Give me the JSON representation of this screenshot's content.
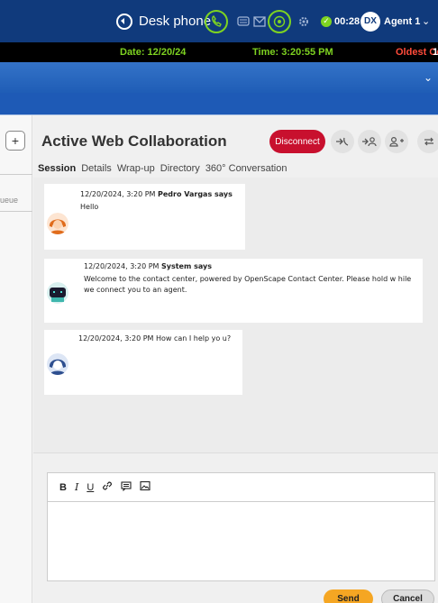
{
  "topbar": {
    "phone_mode_label": "Desk phone",
    "timer": "00:28",
    "agent_initials": "DX",
    "agent_name": "Agent 1"
  },
  "infobar": {
    "date": "Date: 12/20/24",
    "time": "Time: 3:20:55 PM",
    "oldest": "Oldest Co",
    "extra": "1"
  },
  "leftrail": {
    "plus_label": "+",
    "queue_label": "ueue"
  },
  "panel": {
    "title": "Active Web Collaboration",
    "disconnect_label": "Disconnect"
  },
  "tabs": [
    {
      "label": "Session"
    },
    {
      "label": "Details"
    },
    {
      "label": "Wrap-up"
    },
    {
      "label": "Directory"
    },
    {
      "label": "360° Conversation"
    }
  ],
  "messages": [
    {
      "timestamp": "12/20/2024, 3:20 PM",
      "sender": "Pedro Vargas says",
      "text": "Hello"
    },
    {
      "timestamp": "12/20/2024, 3:20 PM",
      "sender": "System says",
      "text": "Welcome to the contact center, powered by OpenScape Contact Center.  Please hold w hile we connect you to an agent."
    },
    {
      "timestamp": "12/20/2024, 3:20 PM",
      "sender": "",
      "text": "How can I help yo u?"
    }
  ],
  "composer": {
    "bold": "B",
    "italic": "I",
    "underline": "U"
  },
  "buttons": {
    "send": "Send",
    "cancel": "Cancel"
  },
  "colors": {
    "topbar": "#103a7c",
    "accent_green": "#7ed321",
    "disconnect": "#c8102e",
    "send": "#f5a623"
  }
}
